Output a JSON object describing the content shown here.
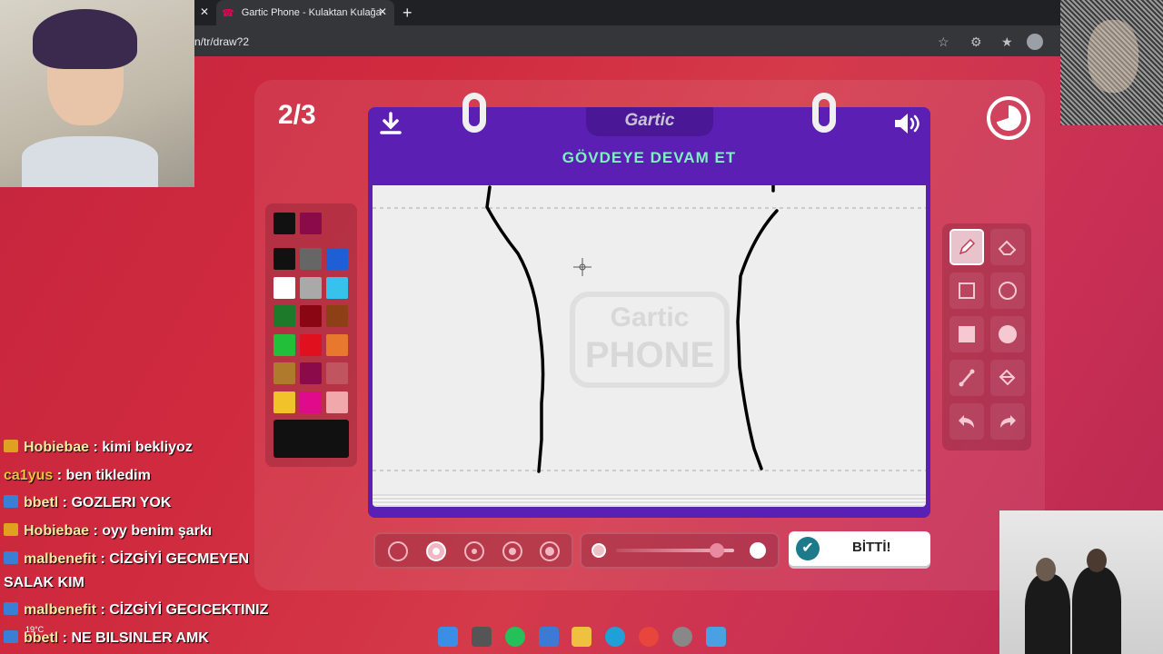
{
  "browser": {
    "tabs": [
      {
        "label": "Gartic Phone - Kulaktan Kulağa",
        "active": true
      }
    ],
    "url": "n/tr/draw?2",
    "new_tab": "+"
  },
  "game": {
    "round": "2/3",
    "logo": "Gartic",
    "prompt": "GÖVDEYE DEVAM ET",
    "done_label": "BİTTİ!",
    "watermark_top": "Gartic",
    "watermark_bottom": "PHONE"
  },
  "palette": {
    "recent": [
      "#111111",
      "#8a0a4a"
    ],
    "colors": [
      "#111111",
      "#666666",
      "#1f5fd6",
      "#ffffff",
      "#a9a9a9",
      "#36c2ec",
      "#1d7a2a",
      "#8a0612",
      "#8d4016",
      "#22c03a",
      "#e0101e",
      "#e8782e",
      "#b07a2c",
      "#8a0a4a",
      "#c05560",
      "#f2c22a",
      "#e00a8a",
      "#f0a8aa"
    ],
    "current": "#111111"
  },
  "tools": [
    "pencil-icon",
    "eraser-icon",
    "rectangle-outline-icon",
    "circle-outline-icon",
    "rectangle-fill-icon",
    "circle-fill-icon",
    "line-icon",
    "fill-bucket-icon",
    "undo-icon",
    "redo-icon"
  ],
  "brush_sizes": {
    "count": 5,
    "selected_index": 1
  },
  "opacity": {
    "value": 0.85
  },
  "chat": [
    {
      "user": "Hobiebae",
      "text": " : kimi bekliyoz",
      "badge": "#e0a020"
    },
    {
      "user": "ca1yus",
      "text": " : ben tikledim",
      "badge": ""
    },
    {
      "user": "bbetl",
      "text": " : GOZLERI YOK",
      "badge": "#3a7fd6"
    },
    {
      "user": "Hobiebae",
      "text": " : oyy benim şarkı",
      "badge": "#e0a020"
    },
    {
      "user": "malbenefit",
      "text": " : CİZGİYİ GECMEYEN",
      "badge": "#3a7fd6"
    },
    {
      "user": "",
      "text": "SALAK KIM",
      "badge": ""
    },
    {
      "user": "malbenefit",
      "text": " : CİZGİYİ GECICEKTINIZ",
      "badge": "#3a7fd6"
    },
    {
      "user": "bbetl",
      "text": " : NE BILSINLER AMK",
      "badge": "#3a7fd6"
    }
  ],
  "taskbar": {
    "weather": "19°C"
  }
}
